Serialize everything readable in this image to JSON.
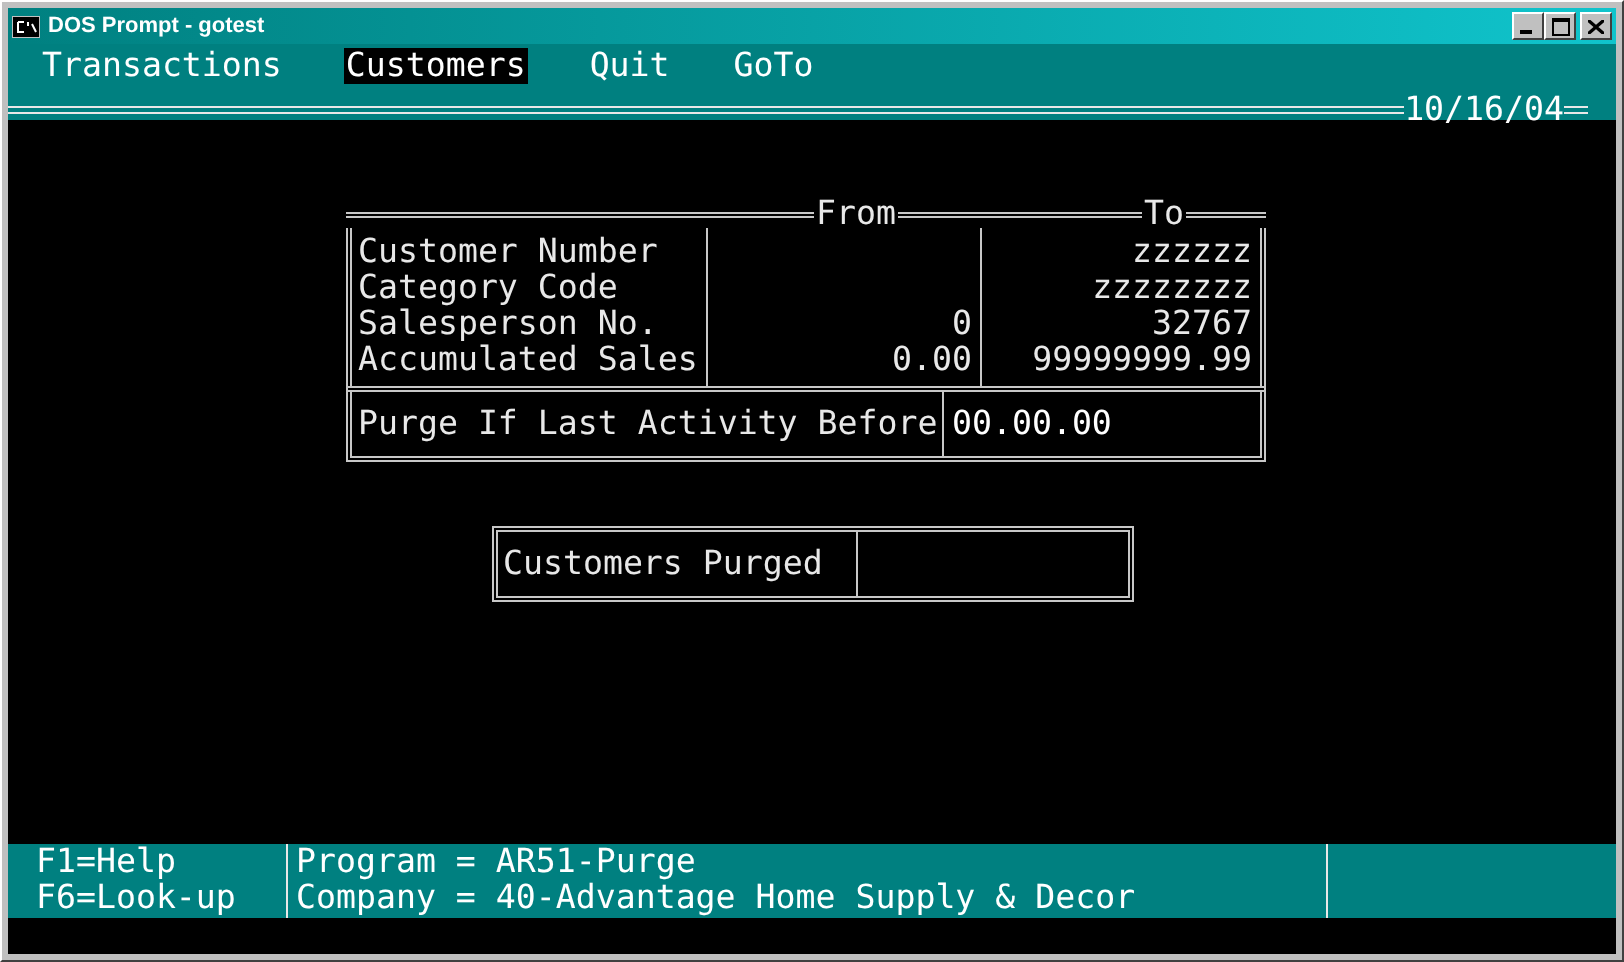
{
  "window": {
    "title": "DOS Prompt - gotest"
  },
  "menu": [
    {
      "label": "Transactions",
      "selected": false
    },
    {
      "label": "Customers",
      "selected": true
    },
    {
      "label": "Quit",
      "selected": false
    },
    {
      "label": "GoTo",
      "selected": false
    }
  ],
  "date": "10/16/04",
  "criteria": {
    "columns": [
      "From",
      "To"
    ],
    "rows": [
      {
        "label": "Customer Number",
        "to": "zzzzzz"
      },
      {
        "label": "Category Code",
        "to": "zzzzzzzz"
      },
      {
        "label": "Salesperson No.",
        "from": "0",
        "to": "32767"
      },
      {
        "label": "Accumulated Sales",
        "from": "0.00",
        "to": "99999999.99"
      }
    ],
    "purge_before": {
      "label": "Purge If Last Activity Before",
      "value": "00.00.00"
    }
  },
  "result": {
    "label": "Customers Purged"
  },
  "status_bar": {
    "keys": [
      "F1=Help",
      "F6=Look-up"
    ],
    "info": [
      "Program = AR51-Purge",
      "Company = 40-Advantage Home Supply & Decor"
    ]
  }
}
